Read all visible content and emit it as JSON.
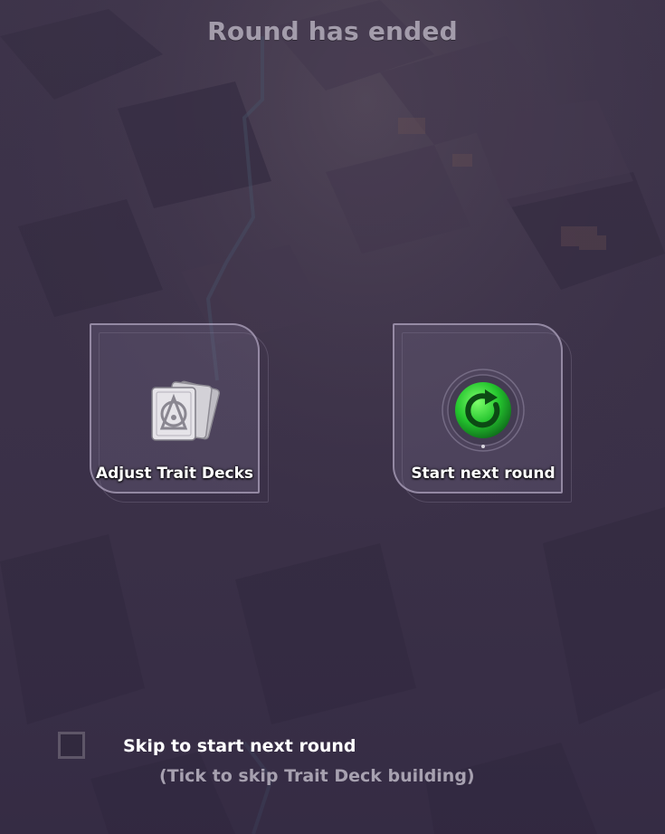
{
  "screen": {
    "title": "Round has ended"
  },
  "options": [
    {
      "label": "Adjust Trait Decks",
      "icon": "trait-deck-cards-icon"
    },
    {
      "label": "Start next round",
      "icon": "restart-round-icon"
    }
  ],
  "skip": {
    "checked": false,
    "label": "Skip to start next round",
    "hint": "(Tick to skip Trait Deck building)"
  },
  "colors": {
    "background": "#3b3148",
    "title": "#a39cab",
    "hint": "#a7a1b0",
    "accent_green": "#2fd43a"
  }
}
